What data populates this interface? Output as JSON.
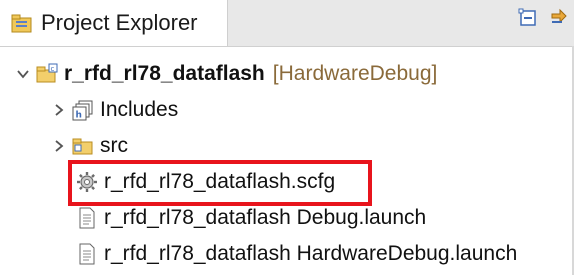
{
  "view": {
    "title": "Project Explorer",
    "icon": "project-explorer-icon",
    "toolbar": [
      {
        "name": "collapse-all-icon"
      },
      {
        "name": "link-with-editor-icon"
      }
    ]
  },
  "tree": {
    "project": {
      "label": "r_rfd_rl78_dataflash",
      "decoration": "[HardwareDebug]",
      "expanded": true,
      "icon": "project-folder-icon"
    },
    "children": [
      {
        "label": "Includes",
        "icon": "includes-icon",
        "expandable": true
      },
      {
        "label": "src",
        "icon": "folder-icon",
        "expandable": true
      },
      {
        "label": "r_rfd_rl78_dataflash.scfg",
        "icon": "gear-file-icon",
        "expandable": false,
        "highlighted": true
      },
      {
        "label": "r_rfd_rl78_dataflash Debug.launch",
        "icon": "launch-file-icon",
        "expandable": false
      },
      {
        "label": "r_rfd_rl78_dataflash HardwareDebug.launch",
        "icon": "launch-file-icon",
        "expandable": false
      }
    ]
  },
  "colors": {
    "highlight": "#e8141c",
    "decoration": "#8a6a3a"
  }
}
